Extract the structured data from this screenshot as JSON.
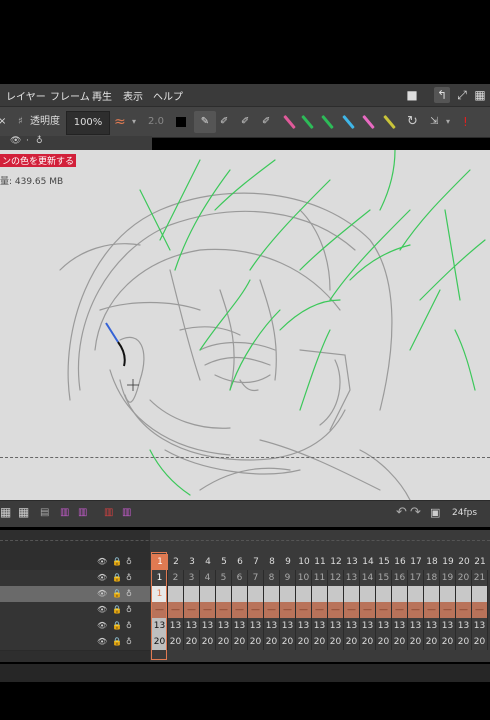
{
  "menu": {
    "items": [
      "レイヤー",
      "フレーム",
      "再生",
      "表示",
      "ヘルプ"
    ]
  },
  "toolbar": {
    "close_glyph": "×",
    "opacity_label": "透明度",
    "opacity_value": "100%",
    "stabilizer_value": "2.0",
    "pen_colors": [
      "#e05a9a",
      "#2dbb58",
      "#2dbb58",
      "#3fb6e8",
      "#e86ac2",
      "#c9c43a",
      "#e02020"
    ]
  },
  "canvas": {
    "overlay_label": "ンの色を更新する",
    "memory_label": "量: 439.65 MB"
  },
  "bottom_bar": {
    "fps": "24fps"
  },
  "timeline": {
    "header_frames": [
      "1",
      "2",
      "3",
      "4",
      "5",
      "6",
      "7",
      "8",
      "9",
      "10",
      "11",
      "12",
      "13",
      "14",
      "15",
      "16",
      "17",
      "18",
      "19",
      "20",
      "21"
    ],
    "rows": [
      {
        "label": "row-1",
        "values": [
          "1",
          "2",
          "3",
          "4",
          "5",
          "6",
          "7",
          "8",
          "9",
          "10",
          "11",
          "12",
          "13",
          "14",
          "15",
          "16",
          "17",
          "18",
          "19",
          "20",
          "21"
        ],
        "selected": false
      },
      {
        "label": "row-2",
        "values": [
          "1",
          "",
          "",
          "",
          "",
          "",
          "",
          "",
          "",
          "",
          "",
          "",
          "",
          "",
          "",
          "",
          "",
          "",
          "",
          "",
          ""
        ],
        "selected": true
      },
      {
        "label": "row-3",
        "values": [
          "—",
          "—",
          "—",
          "—",
          "—",
          "—",
          "—",
          "—",
          "—",
          "—",
          "—",
          "—",
          "—",
          "—",
          "—",
          "—",
          "—",
          "—",
          "—",
          "—",
          "—"
        ],
        "selected": false
      },
      {
        "label": "row-4",
        "values": [
          "13",
          "13",
          "13",
          "13",
          "13",
          "13",
          "13",
          "13",
          "13",
          "13",
          "13",
          "13",
          "13",
          "13",
          "13",
          "13",
          "13",
          "13",
          "13",
          "13",
          "13"
        ],
        "selected": false
      },
      {
        "label": "row-5",
        "values": [
          "20",
          "20",
          "20",
          "20",
          "20",
          "20",
          "20",
          "20",
          "20",
          "20",
          "20",
          "20",
          "20",
          "20",
          "20",
          "20",
          "20",
          "20",
          "20",
          "20",
          "20"
        ],
        "selected": false
      }
    ]
  },
  "colors": {
    "accent": "#e07a52",
    "sketch_gray": "#9a9a9a",
    "sketch_green": "#3cc85a"
  }
}
